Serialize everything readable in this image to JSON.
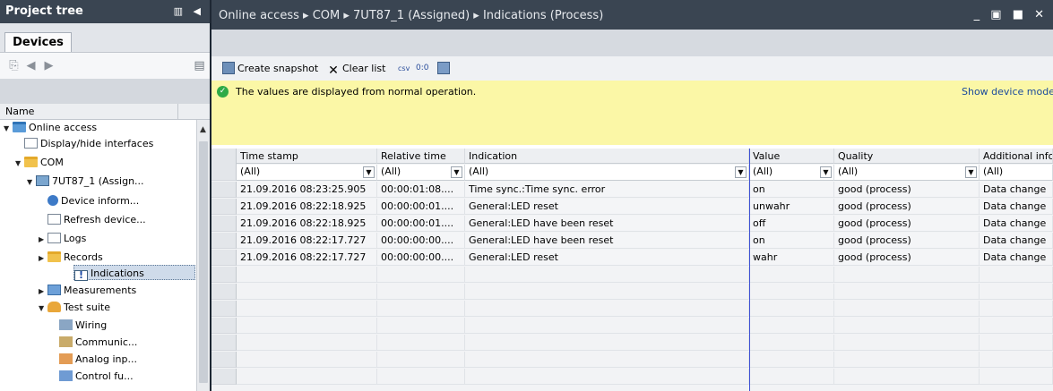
{
  "project_tree": {
    "title": "Project tree",
    "header_icons": "▥ ◀",
    "tab_label": "Devices",
    "column_header": "Name",
    "items": [
      {
        "label": "Online access",
        "indent": 0,
        "twisty": "▼",
        "icon": "online-folder-icon"
      },
      {
        "label": "Display/hide interfaces",
        "indent": 1,
        "twisty": "",
        "icon": "interface-icon"
      },
      {
        "label": "COM",
        "indent": 1,
        "twisty": "▼",
        "icon": "folder-icon"
      },
      {
        "label": "7UT87_1 (Assign...",
        "indent": 2,
        "twisty": "▼",
        "icon": "device-icon"
      },
      {
        "label": "Device inform...",
        "indent": 3,
        "twisty": "",
        "icon": "info-icon"
      },
      {
        "label": "Refresh device...",
        "indent": 3,
        "twisty": "",
        "icon": "refresh-icon"
      },
      {
        "label": "Logs",
        "indent": 3,
        "twisty": "▶",
        "icon": "log-icon"
      },
      {
        "label": "Records",
        "indent": 3,
        "twisty": "▶",
        "icon": "folder-icon"
      },
      {
        "label": "Indications",
        "indent": 3,
        "twisty": "",
        "icon": "indication-icon",
        "selected": true
      },
      {
        "label": "Measurements",
        "indent": 3,
        "twisty": "▶",
        "icon": "measurements-icon"
      },
      {
        "label": "Test suite",
        "indent": 3,
        "twisty": "▼",
        "icon": "test-suite-icon"
      },
      {
        "label": "Wiring",
        "indent": 4,
        "twisty": "",
        "icon": "wiring-icon"
      },
      {
        "label": "Communic...",
        "indent": 4,
        "twisty": "",
        "icon": "communication-icon"
      },
      {
        "label": "Analog inp...",
        "indent": 4,
        "twisty": "",
        "icon": "analog-input-icon"
      },
      {
        "label": "Control fu...",
        "indent": 4,
        "twisty": "",
        "icon": "control-icon"
      }
    ]
  },
  "breadcrumb": [
    "Online access",
    "COM",
    "7UT87_1 (Assigned)",
    "Indications (Process)"
  ],
  "breadcrumb_separator": "▸",
  "window_controls": "_ ▣ ■ ✕",
  "toolbar": {
    "create_snapshot": "Create snapshot",
    "clear_list": "Clear list",
    "csv_label": "csv",
    "counter_label": "0:0"
  },
  "info_bar": {
    "message": "The values are displayed from normal operation.",
    "link": "Show device mode"
  },
  "table": {
    "columns": [
      "Time stamp",
      "Relative time",
      "Indication",
      "Value",
      "Quality",
      "Additional info"
    ],
    "filter_value": "(All)",
    "rows": [
      [
        "21.09.2016 08:23:25.905",
        "00:00:01:08....",
        "Time sync.:Time sync. error",
        "on",
        "good (process)",
        "Data change"
      ],
      [
        "21.09.2016 08:22:18.925",
        "00:00:00:01....",
        "General:LED reset",
        "unwahr",
        "good (process)",
        "Data change"
      ],
      [
        "21.09.2016 08:22:18.925",
        "00:00:00:01....",
        "General:LED have been reset",
        "off",
        "good (process)",
        "Data change"
      ],
      [
        "21.09.2016 08:22:17.727",
        "00:00:00:00....",
        "General:LED have been reset",
        "on",
        "good (process)",
        "Data change"
      ],
      [
        "21.09.2016 08:22:17.727",
        "00:00:00:00....",
        "General:LED reset",
        "wahr",
        "good (process)",
        "Data change"
      ]
    ],
    "empty_rows": 7
  },
  "colors": {
    "header_dark": "#3a4552",
    "info_yellow": "#fbf7a6",
    "selection": "#cfdbea",
    "ok_green": "#2faa47",
    "divider_blue": "#3c4fd4"
  }
}
